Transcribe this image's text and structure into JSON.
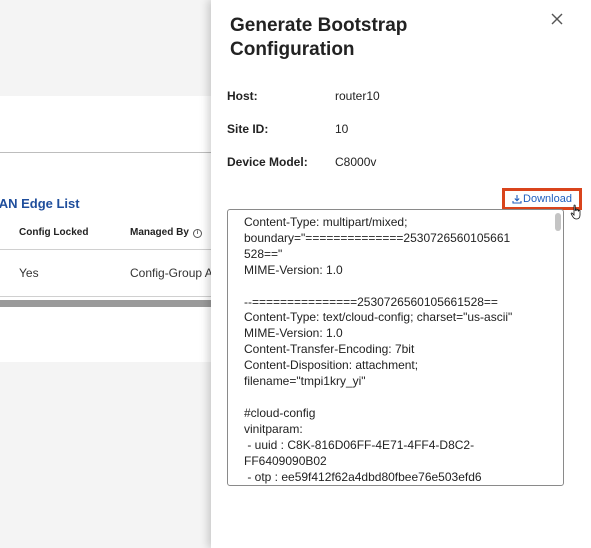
{
  "background": {
    "list_title": "VAN Edge List",
    "columns": [
      "Config Locked",
      "Managed By"
    ],
    "row": {
      "config_locked": "Yes",
      "managed_by": "Config-Group A"
    }
  },
  "drawer": {
    "title": "Generate Bootstrap Configuration",
    "fields": [
      {
        "label": "Host:",
        "value": "router10"
      },
      {
        "label": "Site ID:",
        "value": "10"
      },
      {
        "label": "Device Model:",
        "value": "C8000v"
      }
    ],
    "download_label": "Download",
    "config_text": "Content-Type: multipart/mixed;\nboundary=\"==============2530726560105661\n528==\"\nMIME-Version: 1.0\n\n--===============2530726560105661528==\nContent-Type: text/cloud-config; charset=\"us-ascii\"\nMIME-Version: 1.0\nContent-Transfer-Encoding: 7bit\nContent-Disposition: attachment;\nfilename=\"tmpi1kry_yi\"\n\n#cloud-config\nvinitparam:\n - uuid : C8K-816D06FF-4E71-4FF4-D8C2-\nFF6409090B02\n - otp : ee59f412f62a4dbd80fbee76e503efd6"
  },
  "icons": {
    "close": "close-icon",
    "download": "download-icon",
    "info": "info-icon",
    "cursor": "hand-cursor-icon"
  },
  "colors": {
    "accent_link": "#1f5fbf",
    "highlight_border": "#d9441c",
    "title_link": "#1f4e9c"
  }
}
